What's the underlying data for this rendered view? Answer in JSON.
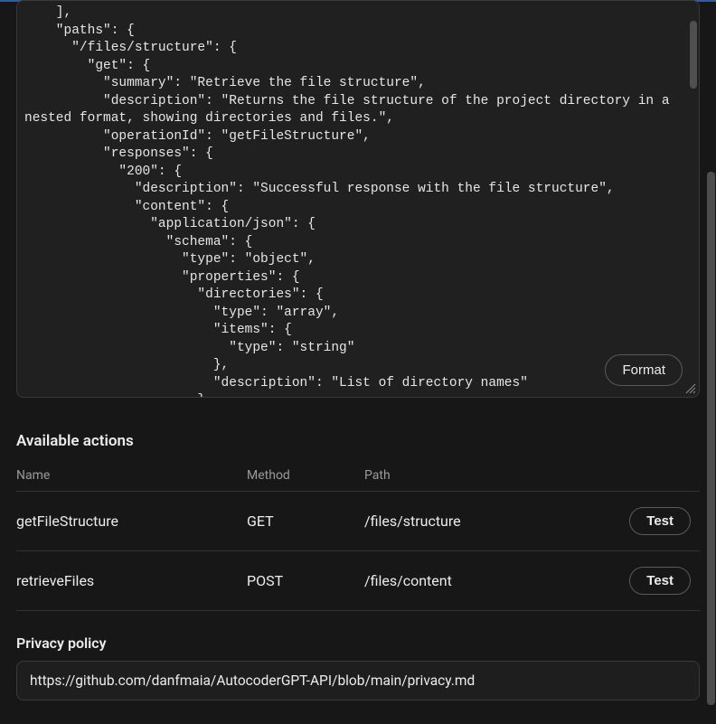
{
  "code_snippet": "    ],\n    \"paths\": {\n      \"/files/structure\": {\n        \"get\": {\n          \"summary\": \"Retrieve the file structure\",\n          \"description\": \"Returns the file structure of the project directory in a\nnested format, showing directories and files.\",\n          \"operationId\": \"getFileStructure\",\n          \"responses\": {\n            \"200\": {\n              \"description\": \"Successful response with the file structure\",\n              \"content\": {\n                \"application/json\": {\n                  \"schema\": {\n                    \"type\": \"object\",\n                    \"properties\": {\n                      \"directories\": {\n                        \"type\": \"array\",\n                        \"items\": {\n                          \"type\": \"string\"\n                        },\n                        \"description\": \"List of directory names\"\n                      },",
  "format_button": "Format",
  "available_actions": {
    "heading": "Available actions",
    "columns": {
      "name": "Name",
      "method": "Method",
      "path": "Path"
    },
    "rows": [
      {
        "name": "getFileStructure",
        "method": "GET",
        "path": "/files/structure",
        "test_label": "Test"
      },
      {
        "name": "retrieveFiles",
        "method": "POST",
        "path": "/files/content",
        "test_label": "Test"
      }
    ]
  },
  "privacy": {
    "label": "Privacy policy",
    "value": "https://github.com/danfmaia/AutocoderGPT-API/blob/main/privacy.md"
  }
}
